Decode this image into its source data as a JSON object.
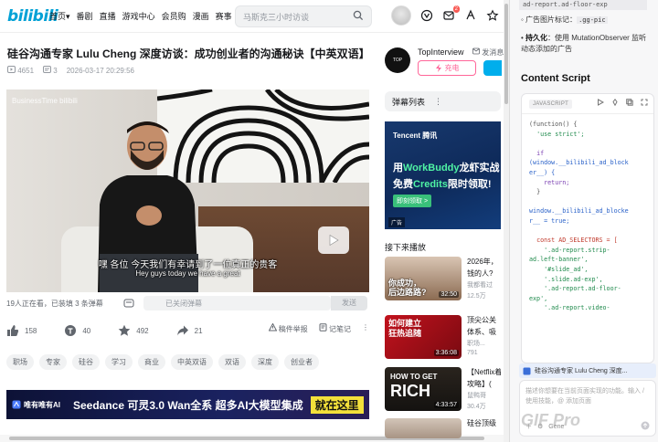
{
  "nav": {
    "logo": "bilibili",
    "items": [
      "首页",
      "番剧",
      "直播",
      "游戏中心",
      "会员购",
      "漫画",
      "赛事"
    ],
    "home_caret": "▾",
    "search_placeholder": "马斯克三小时访谈",
    "notif_badge": "2"
  },
  "video": {
    "title": "硅谷沟通专家 Lulu Cheng 深度访谈：成功创业者的沟通秘诀【中英双语】",
    "plays": "4651",
    "danmaku": "3",
    "datetime": "2026-03-17 20:29:56",
    "watermark": "BusinessTime bilibili",
    "subtitle_cn": "嘿 各位 今天我们有幸请到了一位真正的贵客",
    "subtitle_en": "Hey guys today we have a great"
  },
  "danmaku_bar": {
    "viewers": "19人正在看，已装填 3 条弹幕",
    "placeholder": "已关闭弹幕",
    "send": "发送"
  },
  "actions": {
    "like": "158",
    "coin": "40",
    "fav": "492",
    "share": "21",
    "report": "稿件举报",
    "note": "记笔记"
  },
  "tags": [
    "职场",
    "专家",
    "硅谷",
    "学习",
    "商业",
    "中英双语",
    "双语",
    "深度",
    "创业者"
  ],
  "ad_banner": {
    "brand": "唯有唯有AI",
    "line": "Seedance 可灵3.0 Wan全系 超多AI大模型集成",
    "cta": "就在这里"
  },
  "uploader": {
    "name": "TopInterview",
    "msg": "发消息",
    "charge": "充电"
  },
  "danmaku_list": {
    "label": "弹幕列表",
    "more": "⋮"
  },
  "side_ad": {
    "brand": "Tencent 腾讯",
    "line1_a": "用",
    "line1_b": "WorkBuddy",
    "line1_c": "龙虾实战",
    "line2_a": "免费",
    "line2_b": "Credits",
    "line2_c": "限时领取!",
    "cta": "即刻领取 >",
    "ad_label": "广告"
  },
  "next_label": "接下来播放",
  "recommendations": [
    {
      "title": "2026年，",
      "sub": "钱的人?",
      "up": "我都看过",
      "views": "12.5万",
      "duration": "32:50",
      "bg": "#8b6b52"
    },
    {
      "title": "顶尖公关",
      "sub": "体系、吸",
      "up": "职场...",
      "views": "791",
      "duration": "3:36:08",
      "bg": "#b3101c"
    },
    {
      "title": "【Netflix着",
      "sub": "攻略】(",
      "up": "鼠鸭哥",
      "views": "30.4万",
      "duration": "4:33:57",
      "bg": "#1e1a16"
    },
    {
      "title": "硅谷顶级",
      "sub": "",
      "up": "",
      "views": "",
      "duration": "",
      "bg": "#c7b7a8"
    }
  ],
  "rec_overlays": {
    "r1": "你成功，\n后边路路?",
    "r2": "如何建立\n狂热追随",
    "r3a": "HOW TO GET",
    "r3b": "RICH"
  },
  "panel": {
    "top_code": "ad-report.ad-floor-exp",
    "bullet1_prefix": "◦ 广告图片标记：",
    "bullet1_code": ".gg-pic",
    "bullet2_bold": "持久化",
    "bullet2_text": "：使用 MutationObserver 监听动态添加的广告",
    "heading": "Content Script",
    "lang": "JAVASCRIPT",
    "code_lines": [
      "(function() {",
      "  'use strict';",
      "",
      "  if",
      "(window.__bilibili_ad_block",
      "er__) {",
      "    return;",
      "  }",
      "",
      "window.__bilibili_ad_blocke",
      "r__ = true;",
      "",
      "  const AD_SELECTORS = [",
      "    '.ad-report.strip-",
      "ad.left-banner',",
      "    '#slide_ad',",
      "    '.slide.ad-exp',",
      "    '.ad-report.ad-floor-",
      "exp',",
      "    '.ad-report.video-"
    ],
    "context_label": "硅谷沟通专家 Lulu Cheng 深度...",
    "input_placeholder": "描述你想要在当前页面实现的功能。输入 / 使用技能，@ 添加页面",
    "input_mode": "Gene",
    "watermark": "GIF Pro"
  }
}
